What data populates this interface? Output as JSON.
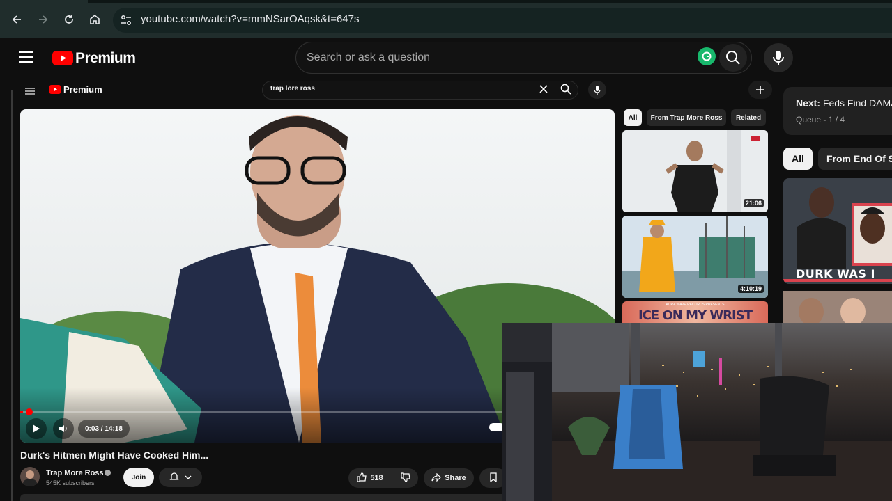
{
  "browser": {
    "url": "youtube.com/watch?v=mmNSarOAqsk&t=647s"
  },
  "header": {
    "logo_text": "Premium",
    "search_placeholder": "Search or ask a question"
  },
  "inner": {
    "logo_text": "Premium",
    "search_query": "trap lore ross",
    "chips": [
      "All",
      "From Trap More Ross",
      "Related"
    ],
    "thumbs": [
      {
        "duration": "21:06"
      },
      {
        "duration": "4:10:19"
      },
      {
        "overlay_text": "ICE ON MY WRIST",
        "small_text": "AURA WAVE RECORDS PRESENTS"
      }
    ],
    "player": {
      "time": "0:03 / 14:18",
      "progress_fraction": 0.0035
    },
    "video_title": "Durk's Hitmen Might Have Cooked Him...",
    "channel": {
      "name": "Trap More Ross",
      "subscribers": "545K subscribers",
      "join_label": "Join"
    },
    "actions": {
      "likes": "518",
      "share_label": "Share"
    }
  },
  "right_panel": {
    "next_label": "Next:",
    "next_title": "Feds Find DAMA",
    "queue": "Queue - 1 / 4",
    "chips": [
      "All",
      "From End Of S"
    ],
    "thumb_text": "DURK WAS I"
  },
  "colors": {
    "brand_red": "#ff0000",
    "browser_bar": "#202d2c",
    "page_bg": "#0f0f0f"
  }
}
